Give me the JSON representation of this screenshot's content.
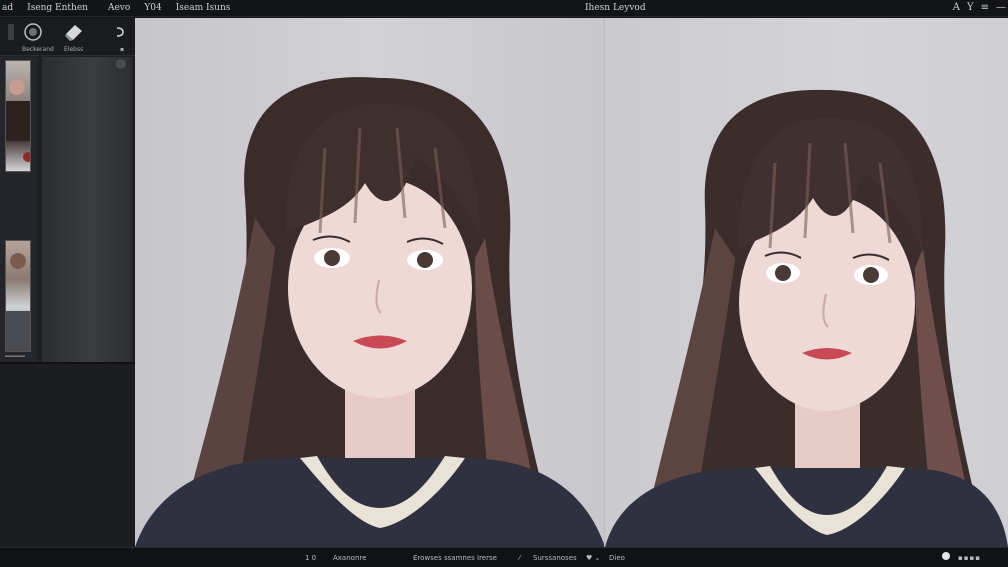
{
  "menu": [
    "ad",
    "Iseng Enthen",
    "Aevo",
    "Y04",
    "Iseam Isuns"
  ],
  "doc_title": "Ihesn Leyvod",
  "top_tools": [
    "A",
    "Y",
    "≡",
    "—"
  ],
  "tool_labels": [
    "Beckerand",
    "Elebss",
    "Dezea"
  ],
  "status": {
    "zoom": "1 0",
    "left_text": "Axanonre",
    "mid_text": "Erowses ssamnes Irerse",
    "info": "Surssanoses",
    "end": "Dieo"
  },
  "colors": {
    "chrome": "#141518",
    "panel": "#1d1f23",
    "canvas": "#c9c8cd",
    "hair": "#3a2c2b",
    "skin": "#efd9d6",
    "sweater": "#2f3140",
    "lace": "#e9e2d7"
  }
}
